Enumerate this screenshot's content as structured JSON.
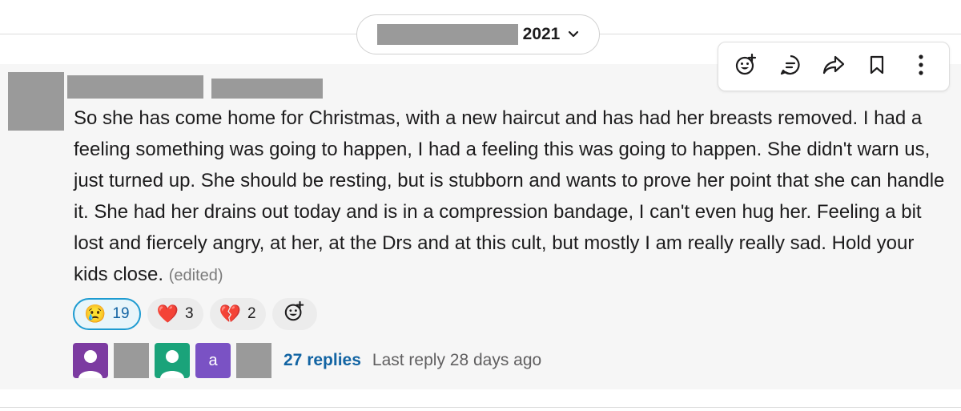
{
  "date_divider": {
    "year": "2021",
    "chevron_icon": "chevron-down-icon"
  },
  "message_actions": [
    {
      "name": "add-reaction",
      "icon": "emoji-add-icon"
    },
    {
      "name": "reply-in-thread",
      "icon": "thread-icon"
    },
    {
      "name": "share-message",
      "icon": "share-icon"
    },
    {
      "name": "save-message",
      "icon": "bookmark-icon"
    },
    {
      "name": "more-actions",
      "icon": "more-vertical-icon"
    }
  ],
  "message": {
    "text": "So she has come home for Christmas, with a new haircut and has had her breasts removed. I had a feeling something was going to happen, I had a feeling this was going to happen. She didn't warn us, just turned up. She should be resting, but is stubborn and wants to prove her point that she can handle it. She had her drains out today and is in a compression bandage, I can't even hug her. Feeling a bit lost and fiercely angry, at her, at the Drs and at this cult, but mostly I am really really sad. Hold your kids close.",
    "edited_label": "(edited)"
  },
  "reactions": [
    {
      "emoji": "😢",
      "icon": "crying-face-icon",
      "count": "19",
      "active": true
    },
    {
      "emoji": "❤️",
      "icon": "red-heart-icon",
      "count": "3",
      "active": false
    },
    {
      "emoji": "💔",
      "icon": "broken-heart-icon",
      "count": "2",
      "active": false
    }
  ],
  "thread": {
    "avatar_letter": "a",
    "replies_label": "27 replies",
    "last_reply_label": "Last reply 28 days ago"
  },
  "colors": {
    "link_blue": "#1264a3",
    "active_reaction_border": "#1d9bd1",
    "redaction_gray": "#9a9a9a"
  }
}
